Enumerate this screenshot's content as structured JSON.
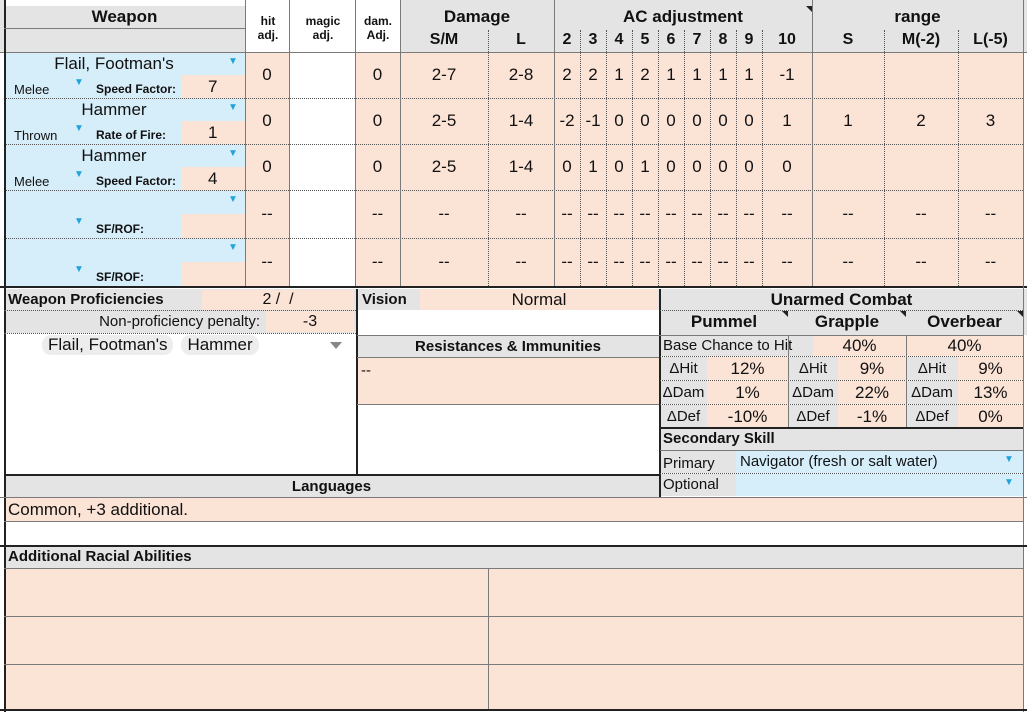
{
  "weapons_header": {
    "weapon": "Weapon",
    "hit_adj": "hit adj.",
    "magic_adj": "magic adj.",
    "dam_adj": "dam. Adj.",
    "damage": "Damage",
    "damage_sm": "S/M",
    "damage_l": "L",
    "ac_adjustment": "AC adjustment",
    "ac_cols": [
      "2",
      "3",
      "4",
      "5",
      "6",
      "7",
      "8",
      "9",
      "10"
    ],
    "range": "range",
    "range_s": "S",
    "range_m": "M(-2)",
    "range_l": "L(-5)"
  },
  "weapons": [
    {
      "name": "Flail, Footman's",
      "type": "Melee",
      "factor_label": "Speed Factor:",
      "factor": "7",
      "hit": "0",
      "magic": "",
      "dam": "0",
      "sm": "2-7",
      "l": "2-8",
      "ac": [
        "2",
        "2",
        "1",
        "2",
        "1",
        "1",
        "1",
        "1",
        "-1"
      ],
      "rs": "",
      "rm": "",
      "rl": ""
    },
    {
      "name": "Hammer",
      "type": "Thrown",
      "factor_label": "Rate of Fire:",
      "factor": "1",
      "hit": "0",
      "magic": "",
      "dam": "0",
      "sm": "2-5",
      "l": "1-4",
      "ac": [
        "-2",
        "-1",
        "0",
        "0",
        "0",
        "0",
        "0",
        "0",
        "1"
      ],
      "rs": "1",
      "rm": "2",
      "rl": "3"
    },
    {
      "name": "Hammer",
      "type": "Melee",
      "factor_label": "Speed Factor:",
      "factor": "4",
      "hit": "0",
      "magic": "",
      "dam": "0",
      "sm": "2-5",
      "l": "1-4",
      "ac": [
        "0",
        "1",
        "0",
        "1",
        "0",
        "0",
        "0",
        "0",
        "0"
      ],
      "rs": "",
      "rm": "",
      "rl": ""
    },
    {
      "name": "",
      "type": "",
      "factor_label": "SF/ROF:",
      "factor": "",
      "hit": "--",
      "magic": "",
      "dam": "--",
      "sm": "--",
      "l": "--",
      "ac": [
        "--",
        "--",
        "--",
        "--",
        "--",
        "--",
        "--",
        "--",
        "--"
      ],
      "rs": "--",
      "rm": "--",
      "rl": "--"
    },
    {
      "name": "",
      "type": "",
      "factor_label": "SF/ROF:",
      "factor": "",
      "hit": "--",
      "magic": "",
      "dam": "--",
      "sm": "--",
      "l": "--",
      "ac": [
        "--",
        "--",
        "--",
        "--",
        "--",
        "--",
        "--",
        "--",
        "--"
      ],
      "rs": "--",
      "rm": "--",
      "rl": "--"
    }
  ],
  "proficiencies": {
    "title": "Weapon Proficiencies",
    "slots": "2 /  /",
    "penalty_label": "Non-proficiency penalty:",
    "penalty": "-3",
    "chips": [
      "Flail, Footman's",
      "Hammer"
    ]
  },
  "vision": {
    "label": "Vision",
    "value": "Normal"
  },
  "resistances": {
    "title": "Resistances & Immunities",
    "value": "--"
  },
  "unarmed": {
    "title": "Unarmed Combat",
    "cols": [
      "Pummel",
      "Grapple",
      "Overbear"
    ],
    "base_label": "Base Chance to Hit",
    "base": [
      "40%",
      "40%"
    ],
    "rows": [
      {
        "label": "ΔHit",
        "values": [
          "12%",
          "9%",
          "9%"
        ]
      },
      {
        "label": "ΔDam",
        "values": [
          "1%",
          "22%",
          "13%"
        ]
      },
      {
        "label": "ΔDef",
        "values": [
          "-10%",
          "-1%",
          "0%"
        ]
      }
    ]
  },
  "secondary": {
    "title": "Secondary Skill",
    "primary_label": "Primary",
    "primary": "Navigator (fresh or salt water)",
    "optional_label": "Optional",
    "optional": ""
  },
  "languages": {
    "title": "Languages",
    "value": "Common, +3 additional."
  },
  "racial": {
    "title": "Additional Racial Abilities"
  }
}
